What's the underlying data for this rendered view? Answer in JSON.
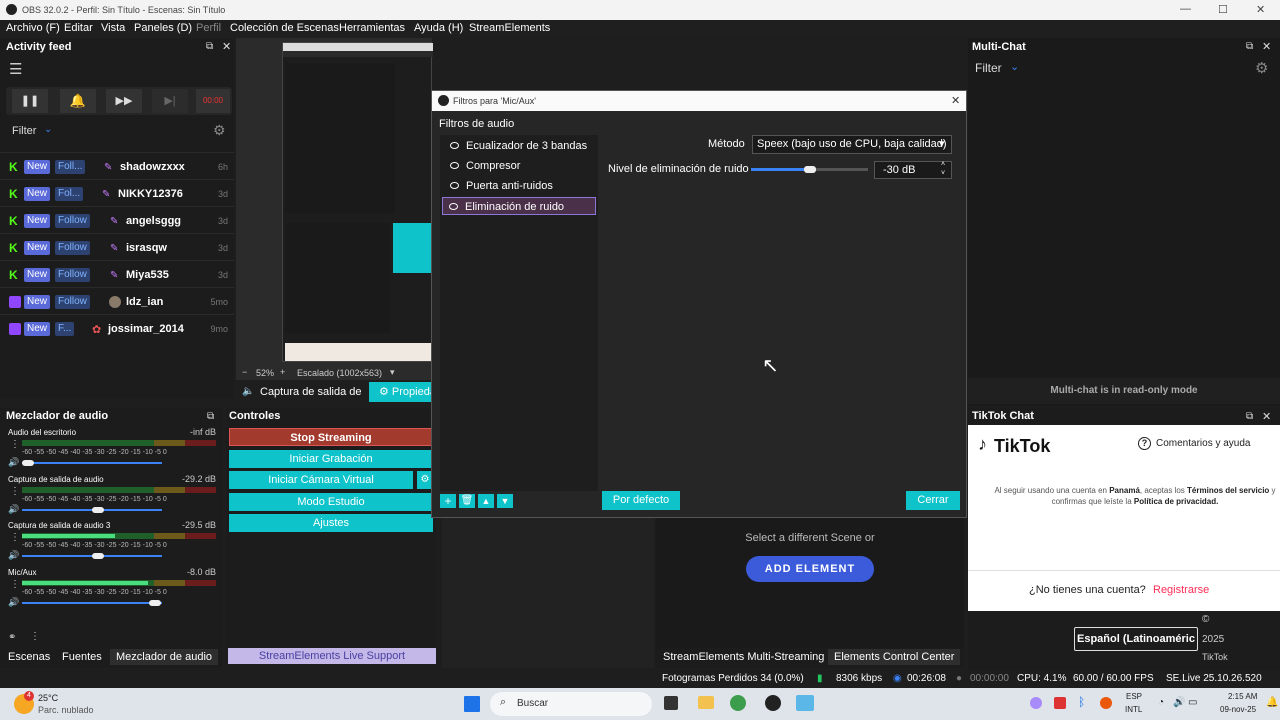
{
  "window": {
    "title": "OBS 32.0.2 - Perfil: Sin Título - Escenas: Sin Título"
  },
  "menu": [
    "Archivo (F)",
    "Editar",
    "Vista",
    "Paneles (D)",
    "Perfil",
    "Colección de Escenas",
    "Herramientas",
    "Ayuda (H)",
    "StreamElements"
  ],
  "activity": {
    "title": "Activity feed",
    "time_display": "00:00",
    "filter_label": "Filter",
    "items": [
      {
        "platform": "kick",
        "new": "New",
        "follow": "Foll...",
        "user": "shadowzxxx",
        "time": "6h"
      },
      {
        "platform": "kick",
        "new": "New",
        "follow": "Fol...",
        "user": "NIKKY12376",
        "time": "3d"
      },
      {
        "platform": "kick",
        "new": "New",
        "follow": "Follow",
        "user": "angelsggg",
        "time": "3d"
      },
      {
        "platform": "kick",
        "new": "New",
        "follow": "Follow",
        "user": "israsqw",
        "time": "3d"
      },
      {
        "platform": "kick",
        "new": "New",
        "follow": "Follow",
        "user": "Miya535",
        "time": "3d"
      },
      {
        "platform": "twitch",
        "new": "New",
        "follow": "Follow",
        "user": "ldz_ian",
        "time": "5mo"
      },
      {
        "platform": "twitch",
        "new": "New",
        "follow": "F...",
        "user": "jossimar_2014",
        "time": "9mo"
      }
    ]
  },
  "preview": {
    "zoom": "52%",
    "scale": "Escalado (1002x563)",
    "source_label": "Captura de salida de",
    "props_button": "Propieda"
  },
  "mixer": {
    "title": "Mezclador de audio",
    "scale": "-60 -55 -50 -45 -40 -35 -30 -25 -20 -15 -10 -5 0",
    "channels": [
      {
        "name": "Audio del escritorio",
        "value": "-inf dB",
        "level": 0.0,
        "volume": 0.0
      },
      {
        "name": "Captura de salida de audio",
        "value": "-29.2 dB",
        "level": 0.0,
        "volume": 0.52
      },
      {
        "name": "Captura de salida de audio 3",
        "value": "-29.5 dB",
        "level": 0.48,
        "volume": 0.52
      },
      {
        "name": "Mic/Aux",
        "value": "-8.0 dB",
        "level": 0.65,
        "volume": 0.95
      }
    ]
  },
  "controls": {
    "title": "Controles",
    "buttons": [
      "Stop Streaming",
      "Iniciar Grabación",
      "Iniciar Cámara Virtual",
      "Modo Estudio",
      "Ajustes"
    ],
    "support": "StreamElements Live Support"
  },
  "left_tabs": [
    "Escenas",
    "Fuentes",
    "Mezclador de audio"
  ],
  "dialog": {
    "title": "Filtros para 'Mic/Aux'",
    "section": "Filtros de audio",
    "filters": [
      "Ecualizador de 3 bandas",
      "Compresor",
      "Puerta anti-ruidos",
      "Eliminación de ruido"
    ],
    "method_label": "Método",
    "method_value": "Speex (bajo uso de CPU, baja calidad)",
    "level_label": "Nivel de eliminación de ruido",
    "level_value": "-30 dB",
    "level_fraction": 0.5,
    "default_button": "Por defecto",
    "close_button": "Cerrar"
  },
  "scene_panel": {
    "message": "Select a different Scene or",
    "button": "ADD ELEMENT"
  },
  "multichat": {
    "title": "Multi-Chat",
    "filter": "Filter",
    "readonly": "Multi-chat is in read-only mode"
  },
  "tiktok": {
    "title": "TikTok Chat",
    "logo": "TikTok",
    "help": "Comentarios y ayuda",
    "terms_1": "Al seguir usando una cuenta en",
    "terms_country": "Panamá",
    "terms_2": ", aceptas los",
    "terms_3": "Términos del servicio",
    "terms_4": "y confirmas que leíste la",
    "terms_5": "Política de privacidad.",
    "no_account": "¿No tienes una cuenta?",
    "register": "Registrarse",
    "copyright": "©",
    "year": "2025",
    "brand": "TikTok",
    "language": "Español (Latinoaméric"
  },
  "bottom_tabs": [
    "StreamElements Multi-Streaming",
    "Elements Control Center"
  ],
  "status": {
    "dropped": "Fotogramas Perdidos 34 (0.0%)",
    "bitrate": "8306 kbps",
    "stream_time": "00:26:08",
    "rec_time": "00:00:00",
    "cpu": "CPU: 4.1%",
    "fps": "60.00 / 60.00 FPS",
    "version": "SE.Live 25.10.26.520"
  },
  "taskbar": {
    "weather_temp": "25°C",
    "weather_desc": "Parc. nublado",
    "search": "Buscar",
    "lang": "ESP",
    "lang2": "INTL",
    "time": "2:15 AM",
    "date": "09-nov-25",
    "notif": "4"
  }
}
